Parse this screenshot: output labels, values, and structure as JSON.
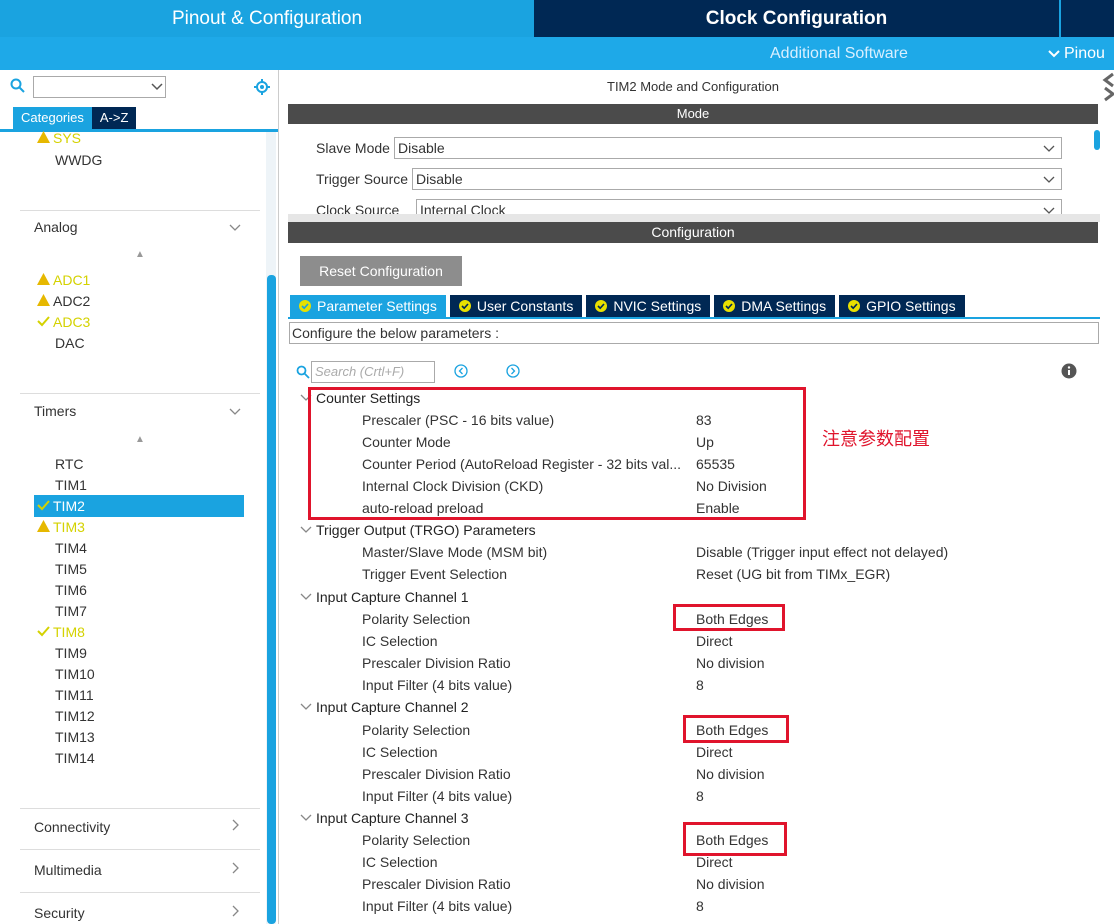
{
  "header": {
    "tab_pinout": "Pinout & Configuration",
    "tab_clock": "Clock Configuration",
    "additional_software": "Additional Software",
    "pinout_view": "Pinou"
  },
  "left": {
    "tab_categories": "Categories",
    "tab_az": "A->Z",
    "system_items": [
      {
        "label": "SYS",
        "status": "warn"
      },
      {
        "label": "WWDG",
        "status": "none"
      }
    ],
    "analog": {
      "label": "Analog",
      "items": [
        {
          "label": "ADC1",
          "status": "warn"
        },
        {
          "label": "ADC2",
          "status": "warn"
        },
        {
          "label": "ADC3",
          "status": "ok"
        },
        {
          "label": "DAC",
          "status": "none"
        }
      ]
    },
    "timers": {
      "label": "Timers",
      "items": [
        {
          "label": "RTC",
          "status": "none"
        },
        {
          "label": "TIM1",
          "status": "none"
        },
        {
          "label": "TIM2",
          "status": "ok",
          "selected": true
        },
        {
          "label": "TIM3",
          "status": "warn"
        },
        {
          "label": "TIM4",
          "status": "none"
        },
        {
          "label": "TIM5",
          "status": "none"
        },
        {
          "label": "TIM6",
          "status": "none"
        },
        {
          "label": "TIM7",
          "status": "none"
        },
        {
          "label": "TIM8",
          "status": "ok"
        },
        {
          "label": "TIM9",
          "status": "none"
        },
        {
          "label": "TIM10",
          "status": "none"
        },
        {
          "label": "TIM11",
          "status": "none"
        },
        {
          "label": "TIM12",
          "status": "none"
        },
        {
          "label": "TIM13",
          "status": "none"
        },
        {
          "label": "TIM14",
          "status": "none"
        }
      ]
    },
    "connectivity": "Connectivity",
    "multimedia": "Multimedia",
    "security": "Security"
  },
  "right": {
    "title": "TIM2 Mode and Configuration",
    "mode_header": "Mode",
    "slave_mode_label": "Slave Mode",
    "slave_mode_value": "Disable",
    "trigger_source_label": "Trigger Source",
    "trigger_source_value": "Disable",
    "clock_source_label": "Clock Source",
    "clock_source_value": "Internal Clock",
    "config_header": "Configuration",
    "reset_button": "Reset Configuration",
    "tabs": [
      "Parameter Settings",
      "User Constants",
      "NVIC Settings",
      "DMA Settings",
      "GPIO Settings"
    ],
    "configure_msg": "Configure the below parameters :",
    "search_placeholder": "Search (Crtl+F)",
    "annotation": "注意参数配置",
    "counter": {
      "title": "Counter Settings",
      "rows": [
        {
          "label": "Prescaler (PSC - 16 bits value)",
          "value": "83"
        },
        {
          "label": "Counter Mode",
          "value": "Up"
        },
        {
          "label": "Counter Period (AutoReload Register - 32 bits val...",
          "value": "65535"
        },
        {
          "label": "Internal Clock Division (CKD)",
          "value": "No Division"
        },
        {
          "label": "auto-reload preload",
          "value": "Enable"
        }
      ]
    },
    "trgo": {
      "title": "Trigger Output (TRGO) Parameters",
      "rows": [
        {
          "label": "Master/Slave Mode (MSM bit)",
          "value": "Disable (Trigger input effect not delayed)"
        },
        {
          "label": "Trigger Event Selection",
          "value": "Reset (UG bit from TIMx_EGR)"
        }
      ]
    },
    "ic1": {
      "title": "Input Capture Channel 1",
      "rows": [
        {
          "label": "Polarity Selection",
          "value": "Both Edges"
        },
        {
          "label": "IC Selection",
          "value": "Direct"
        },
        {
          "label": "Prescaler Division Ratio",
          "value": "No division"
        },
        {
          "label": "Input Filter (4 bits value)",
          "value": "8"
        }
      ]
    },
    "ic2": {
      "title": "Input Capture Channel 2",
      "rows": [
        {
          "label": "Polarity Selection",
          "value": "Both Edges"
        },
        {
          "label": "IC Selection",
          "value": "Direct"
        },
        {
          "label": "Prescaler Division Ratio",
          "value": "No division"
        },
        {
          "label": "Input Filter (4 bits value)",
          "value": "8"
        }
      ]
    },
    "ic3": {
      "title": "Input Capture Channel 3",
      "rows": [
        {
          "label": "Polarity Selection",
          "value": "Both Edges"
        },
        {
          "label": "IC Selection",
          "value": "Direct"
        },
        {
          "label": "Prescaler Division Ratio",
          "value": "No division"
        },
        {
          "label": "Input Filter (4 bits value)",
          "value": "8"
        }
      ]
    }
  },
  "colors": {
    "accent_blue": "#1aa3e0",
    "dark_navy": "#002854",
    "warning_yellow": "#d4d200",
    "annotation_red": "#e0142c"
  }
}
